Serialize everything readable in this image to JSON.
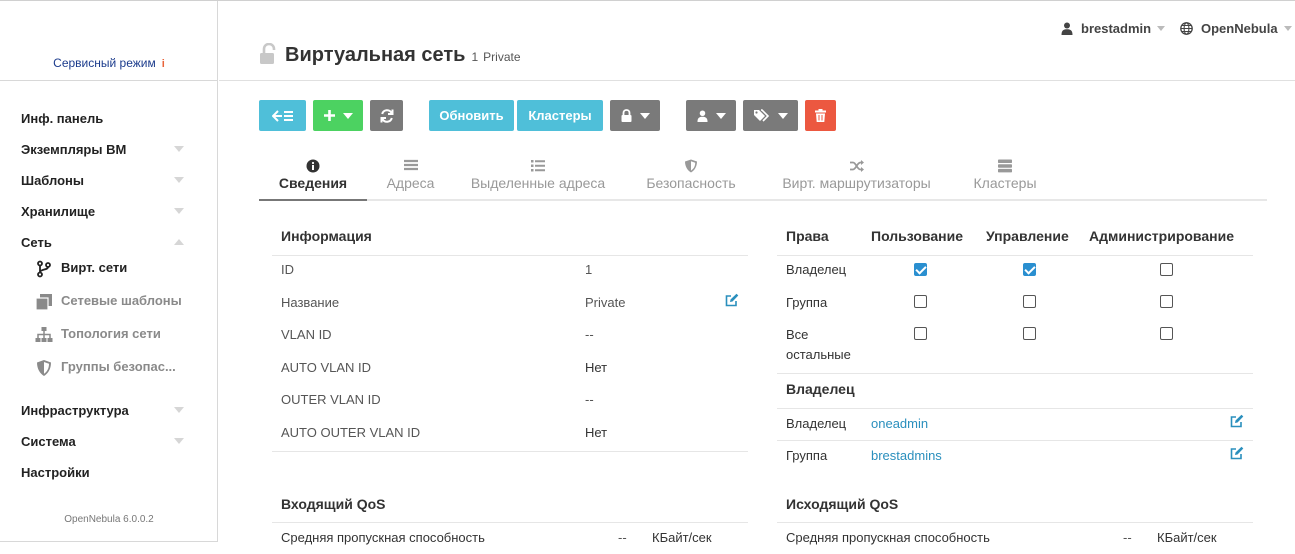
{
  "sidebar": {
    "service_mode": "Сервисный режим",
    "service_mode_info": "i",
    "items": [
      {
        "label": "Инф. панель"
      },
      {
        "label": "Экземпляры ВМ"
      },
      {
        "label": "Шаблоны"
      },
      {
        "label": "Хранилище"
      },
      {
        "label": "Сеть"
      }
    ],
    "network_sub": [
      {
        "label": "Вирт. сети",
        "icon": "branch-icon"
      },
      {
        "label": "Сетевые шаблоны",
        "icon": "copy-icon"
      },
      {
        "label": "Топология сети",
        "icon": "sitemap-icon"
      },
      {
        "label": "Группы безопас...",
        "icon": "shield-icon"
      }
    ],
    "items_after": [
      {
        "label": "Инфраструктура"
      },
      {
        "label": "Система"
      },
      {
        "label": "Настройки"
      }
    ],
    "version": "OpenNebula 6.0.0.2"
  },
  "header": {
    "title": "Виртуальная сеть",
    "id": "1",
    "name": "Private",
    "user": "brestadmin",
    "zone": "OpenNebula"
  },
  "toolbar": {
    "update_label": "Обновить",
    "clusters_label": "Кластеры"
  },
  "tabs": [
    {
      "label": "Сведения",
      "icon": "info-icon"
    },
    {
      "label": "Адреса",
      "icon": "list-icon"
    },
    {
      "label": "Выделенные адреса",
      "icon": "list-icon"
    },
    {
      "label": "Безопасность",
      "icon": "shield-icon"
    },
    {
      "label": "Вирт. маршрутизаторы",
      "icon": "random-icon"
    },
    {
      "label": "Кластеры",
      "icon": "server-icon"
    }
  ],
  "info": {
    "title": "Информация",
    "rows": [
      {
        "key": "ID",
        "value": "1"
      },
      {
        "key": "Название",
        "value": "Private"
      },
      {
        "key": "VLAN ID",
        "value": "--"
      },
      {
        "key": "AUTO VLAN ID",
        "value": "Нет"
      },
      {
        "key": "OUTER VLAN ID",
        "value": "--"
      },
      {
        "key": "AUTO OUTER VLAN ID",
        "value": "Нет"
      }
    ]
  },
  "permissions": {
    "headers": [
      "Права",
      "Пользование",
      "Управление",
      "Администрирование"
    ],
    "rows": [
      {
        "label": "Владелец",
        "use": true,
        "manage": true,
        "admin": false
      },
      {
        "label": "Группа",
        "use": false,
        "manage": false,
        "admin": false
      },
      {
        "label_1": "Все",
        "label_2": "остальные",
        "use": false,
        "manage": false,
        "admin": false
      }
    ]
  },
  "ownership": {
    "title": "Владелец",
    "owner_label": "Владелец",
    "owner_value": "oneadmin",
    "group_label": "Группа",
    "group_value": "brestadmins"
  },
  "qos_in": {
    "title": "Входящий QoS",
    "row_label": "Средняя пропускная способность",
    "row_value": "--",
    "row_unit": "КБайт/сек"
  },
  "qos_out": {
    "title": "Исходящий QoS",
    "row_label": "Средняя пропускная способность",
    "row_value": "--",
    "row_unit": "КБайт/сек"
  },
  "colors": {
    "accent": "#4fbfd9",
    "green": "#4cd261",
    "gray": "#7a7a7a",
    "danger": "#ec5840",
    "link": "#2a8fbd",
    "service_mode": "#1b3b8c"
  }
}
